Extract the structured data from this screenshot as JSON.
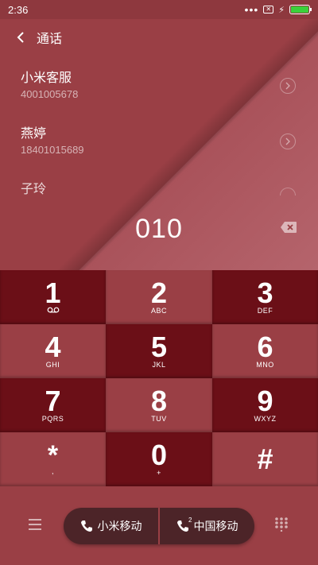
{
  "status_bar": {
    "time": "2:36",
    "dots": "•••",
    "sim_icon": "no-sim-icon",
    "charging_icon": "bolt-icon",
    "battery_color": "#3bd13b"
  },
  "header": {
    "back_icon": "chevron-left-icon",
    "title": "通话"
  },
  "contacts": [
    {
      "name": "小米客服",
      "number": "4001005678"
    },
    {
      "name": "燕婷",
      "number": "18401015689"
    },
    {
      "name": "子玲",
      "number": ""
    }
  ],
  "dial": {
    "number": "010",
    "backspace_icon": "backspace-icon"
  },
  "keypad": [
    {
      "digit": "1",
      "sub": "",
      "tone": "dark",
      "icon": "voicemail-icon"
    },
    {
      "digit": "2",
      "sub": "ABC",
      "tone": "light"
    },
    {
      "digit": "3",
      "sub": "DEF",
      "tone": "dark"
    },
    {
      "digit": "4",
      "sub": "GHI",
      "tone": "light"
    },
    {
      "digit": "5",
      "sub": "JKL",
      "tone": "dark"
    },
    {
      "digit": "6",
      "sub": "MNO",
      "tone": "light"
    },
    {
      "digit": "7",
      "sub": "PQRS",
      "tone": "dark"
    },
    {
      "digit": "8",
      "sub": "TUV",
      "tone": "light"
    },
    {
      "digit": "9",
      "sub": "WXYZ",
      "tone": "dark"
    },
    {
      "digit": "*",
      "sub": ",",
      "tone": "light"
    },
    {
      "digit": "0",
      "sub": "+",
      "tone": "dark"
    },
    {
      "digit": "#",
      "sub": "",
      "tone": "light"
    }
  ],
  "bottom": {
    "menu_icon": "menu-icon",
    "dialpad_icon": "dialpad-icon",
    "sim1_label": "小米移动",
    "sim2_label": "中国移动",
    "sim2_index": "2"
  },
  "colors": {
    "background": "#9a3f45",
    "dark_key": "#6b0f17",
    "call_group": "#4c2428"
  }
}
